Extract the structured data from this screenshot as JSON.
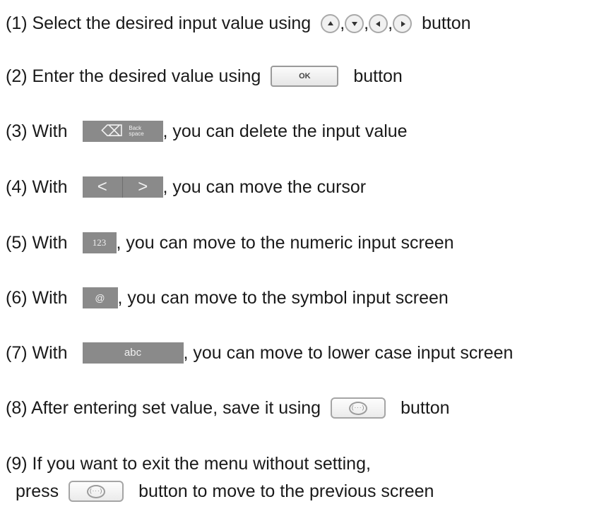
{
  "instructions": {
    "step1": {
      "prefix": "(1) Select the desired input value using",
      "sep1": ",",
      "sep2": ",",
      "sep3": ",",
      "suffix": "button"
    },
    "step2": {
      "prefix": "(2) Enter the desired value using",
      "button_text": "OK",
      "suffix": "button"
    },
    "step3": {
      "prefix": "(3) With",
      "key_glyph": "⌫",
      "key_text_line1": "Back",
      "key_text_line2": "space",
      "suffix": ", you can delete the input value"
    },
    "step4": {
      "prefix": "(4) With",
      "left_glyph": "<",
      "right_glyph": ">",
      "suffix": ", you can move the cursor"
    },
    "step5": {
      "prefix": "(5) With",
      "key_text": "123",
      "suffix": ", you can move to the numeric input screen"
    },
    "step6": {
      "prefix": "(6) With",
      "key_text": "@",
      "suffix": ", you can move to the symbol input screen"
    },
    "step7": {
      "prefix": "(7) With",
      "key_text": "abc",
      "suffix": ", you can move to lower case input screen"
    },
    "step8": {
      "prefix": "(8) After entering set value, save it using",
      "icon_text": "(···)",
      "suffix": "button"
    },
    "step9": {
      "line1": "(9) If you want to exit the menu without setting,",
      "prefix": "press",
      "icon_text": "(···)",
      "suffix": "button to move to the previous screen"
    }
  },
  "icons": {
    "arrow_up": "arrow-up-icon",
    "arrow_down": "arrow-down-icon",
    "arrow_left": "arrow-left-icon",
    "arrow_right": "arrow-right-icon",
    "message": "message-icon",
    "backspace": "backspace-icon"
  },
  "colors": {
    "key_gray": "#8a8a8a",
    "text": "#1a1a1a"
  }
}
